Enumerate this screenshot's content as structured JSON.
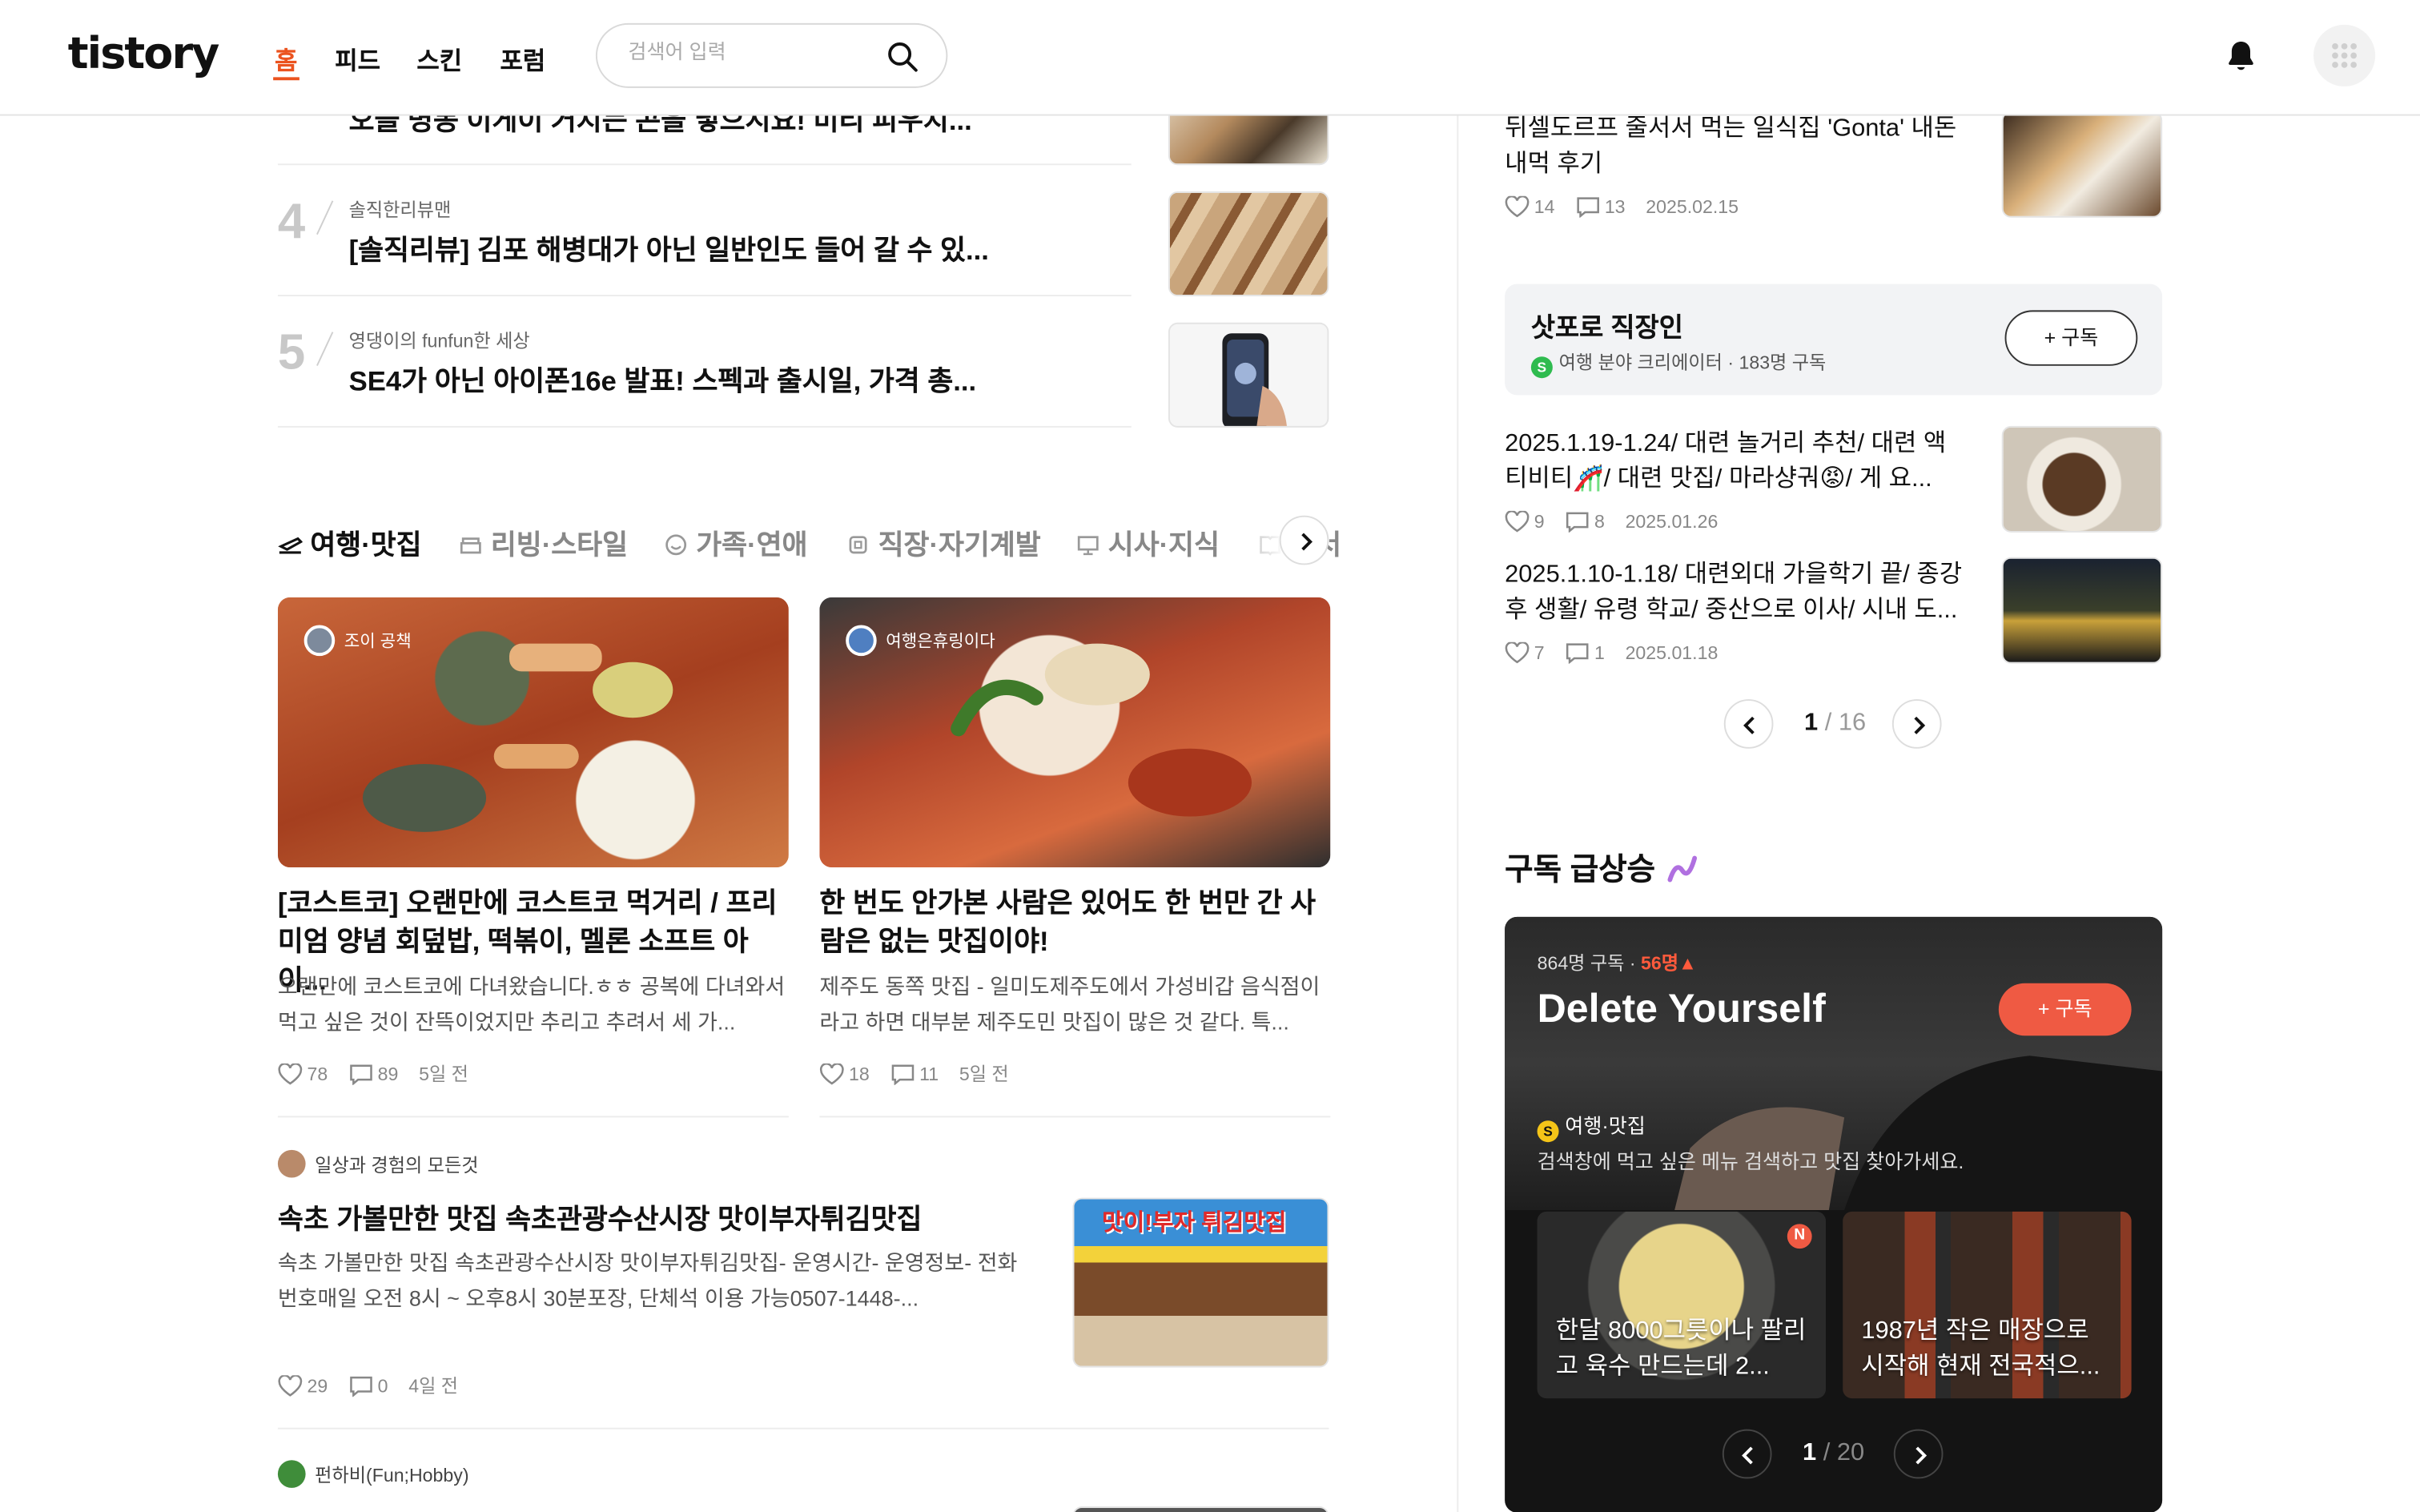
{
  "header": {
    "logo": "tistory",
    "nav": [
      "홈",
      "피드",
      "스킨",
      "포럼"
    ],
    "search_placeholder": "검색어 입력"
  },
  "ranking": [
    {
      "num": "",
      "blog": "",
      "title": "오늘 명동 이게이 거지는 콘을 넣으시요! 미리 피우지..."
    },
    {
      "num": "4",
      "blog": "솔직한리뷰맨",
      "title": "[솔직리뷰] 김포 해병대가 아닌 일반인도 들어 갈 수 있..."
    },
    {
      "num": "5",
      "blog": "영댕이의 funfun한 세상",
      "title": "SE4가 아닌 아이폰16e 발표! 스펙과 출시일, 가격 총..."
    }
  ],
  "categories": [
    "여행·맛집",
    "리빙·스타일",
    "가족·연애",
    "직장·자기계발",
    "시사·지식",
    "도서"
  ],
  "cards": [
    {
      "blog": "조이 공책",
      "title": "[코스트코] 오랜만에 코스트코 먹거리 / 프리미엄 양념 회덮밥, 떡볶이, 멜론 소프트 아이...",
      "desc": "오랜만에 코스트코에 다녀왔습니다.ㅎㅎ 공복에 다녀와서 먹고 싶은 것이 잔뜩이었지만 추리고 추려서 세 가...",
      "likes": "78",
      "comments": "89",
      "time": "5일 전"
    },
    {
      "blog": "여행은휴링이다",
      "title": "한 번도 안가본 사람은 있어도 한 번만 간 사람은 없는 맛집이야!",
      "desc": "제주도 동쪽 맛집 - 일미도제주도에서 가성비갑 음식점이라고 하면 대부분 제주도민 맛집이 많은 것 같다. 특...",
      "likes": "18",
      "comments": "11",
      "time": "5일 전"
    }
  ],
  "list_post": {
    "blog": "일상과 경험의 모든것",
    "title": "속초 가볼만한 맛집 속초관광수산시장 맛이부자튀김맛집",
    "desc": "속초 가볼만한 맛집 속초관광수산시장 맛이부자튀김맛집- 운영시간- 운영정보- 전화번호매일 오전 8시 ~ 오후8시 30분포장, 단체석 이용 가능0507-1448-...",
    "likes": "29",
    "comments": "0",
    "time": "4일 전",
    "sign_text": "맛이!부자 튀김맛집"
  },
  "next_blog": "펀하비(Fun;Hobby)",
  "right_top_post": {
    "title": "뒤셀도르프 줄서서 먹는 일식집 'Gonta' 내돈내먹 후기",
    "likes": "14",
    "comments": "13",
    "date": "2025.02.15"
  },
  "subscribe_box": {
    "name": "삿포로 직장인",
    "meta": "여행 분야 크리에이터 · 183명 구독",
    "button": "+ 구독"
  },
  "right_posts": [
    {
      "title": "2025.1.19-1.24/ 대련 놀거리 추천/ 대련 액티비티🎢/ 대련 맛집/ 마라샹궈😡/ 게 요...",
      "likes": "9",
      "comments": "8",
      "date": "2025.01.26"
    },
    {
      "title": "2025.1.10-1.18/ 대련외대 가을학기 끝/ 종강 후 생활/ 유령 학교/ 중산으로 이사/ 시내 도...",
      "likes": "7",
      "comments": "1",
      "date": "2025.01.18"
    }
  ],
  "right_pager": {
    "current": "1",
    "total": "/ 16"
  },
  "trending": {
    "heading": "구독 급상승",
    "subs": "864명 구독 ·",
    "delta": "56명",
    "name": "Delete Yourself",
    "button": "+ 구독",
    "category": "여행·맛집",
    "desc": "검색창에 먹고 싶은 메뉴 검색하고 맛집 찾아가세요.",
    "minis": [
      {
        "text": "한달 8000그릇이나 팔리고 육수 만드는데 2...",
        "badge": "N"
      },
      {
        "text": "1987년 작은 매장으로 시작해 현재 전국적으..."
      }
    ],
    "pager": {
      "current": "1",
      "total": "/ 20"
    }
  },
  "colors": {
    "accent": "#eb531f",
    "subscribe": "#ef5a43",
    "badge_green": "#2fbb4f"
  }
}
